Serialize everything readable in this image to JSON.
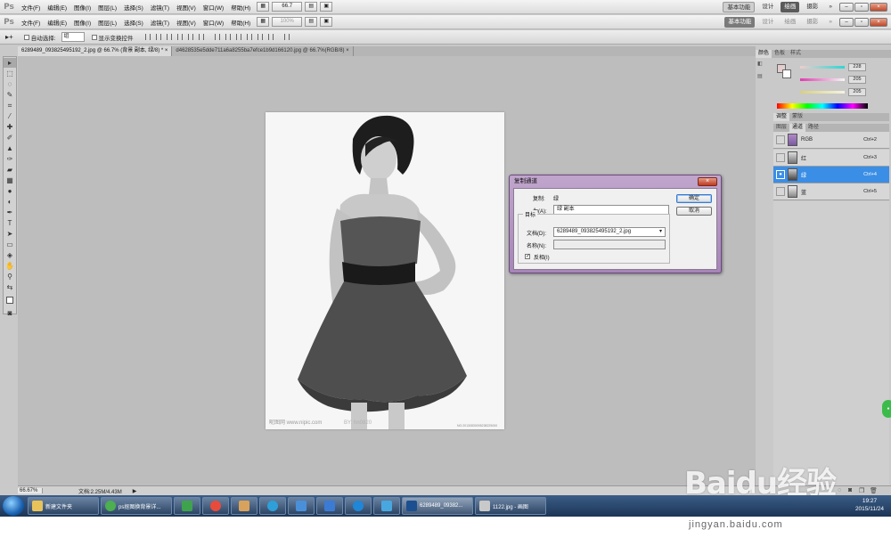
{
  "app": {
    "logo": "Ps",
    "menus": [
      "文件(F)",
      "编辑(E)",
      "图像(I)",
      "图层(L)",
      "选择(S)",
      "滤镜(T)",
      "视图(V)",
      "窗口(W)",
      "帮助(H)"
    ],
    "zoom_select": "66.7",
    "zoom_select_bg": "100%",
    "workspaces": [
      "基本功能",
      "设计",
      "绘画",
      "摄影"
    ],
    "active_workspace": "绘画",
    "more": "»"
  },
  "options_bar": {
    "auto_select_label": "自动选择:",
    "auto_select_value": "组",
    "show_transform_label": "显示变换控件"
  },
  "tabs": [
    {
      "label": "6289489_093825495192_2.jpg @ 66.7% (背景 副本, 绿/8) *",
      "close": "×"
    },
    {
      "label": "d4628535e5dde711a6a8255ba7efce1b9d166120.jpg @ 66.7%(RGB/8)",
      "close": "×"
    }
  ],
  "panels": {
    "color_tabs": [
      "颜色",
      "色板",
      "样式"
    ],
    "color_values": [
      "228",
      "205",
      "205"
    ],
    "adjust_tabs": [
      "调整",
      "蒙版"
    ],
    "channel_tabs": [
      "图层",
      "通道",
      "路径"
    ],
    "channels": [
      {
        "name": "RGB",
        "shortcut": "Ctrl+2",
        "selected": false
      },
      {
        "name": "红",
        "shortcut": "Ctrl+3",
        "selected": false
      },
      {
        "name": "绿",
        "shortcut": "Ctrl+4",
        "selected": true
      },
      {
        "name": "蓝",
        "shortcut": "Ctrl+5",
        "selected": false
      }
    ]
  },
  "dialog": {
    "title": "复制通道",
    "copy_label": "复制:",
    "copy_value": "绿",
    "as_label": "为(A):",
    "as_value": "绿 副本",
    "target_label": "目标",
    "doc_label": "文档(D):",
    "doc_value": "6289489_093825495192_2.jpg",
    "name_label": "名称(N):",
    "name_value": "",
    "invert_label": "反相(I)",
    "invert_checked": true,
    "ok_label": "确定",
    "cancel_label": "取消",
    "close": "×"
  },
  "photo_texts": {
    "watermark_left": "昵图网 www.nipic.com",
    "watermark_by": "BY: hn0820",
    "watermark_id": "NO:20130830095238225000"
  },
  "status": {
    "zoom": "66.67%",
    "doc_info": "文档:2.25M/4.43M"
  },
  "taskbar": {
    "items": [
      {
        "label": "新建文件夹",
        "icon_color": "#e8c35a",
        "type": "wide"
      },
      {
        "label": "ps抠图换背景详...",
        "icon_color": "#4caf50",
        "type": "wide"
      },
      {
        "label": "",
        "icon_color": "#3fa34d",
        "type": "icon"
      },
      {
        "label": "",
        "icon_color": "#e84b3c",
        "type": "icon"
      },
      {
        "label": "",
        "icon_color": "#d9a25c",
        "type": "icon"
      },
      {
        "label": "",
        "icon_color": "#2e9fd8",
        "type": "icon"
      },
      {
        "label": "",
        "icon_color": "#4a90d9",
        "type": "icon"
      },
      {
        "label": "",
        "icon_color": "#3b7bd4",
        "type": "icon"
      },
      {
        "label": "",
        "icon_color": "#1f86d8",
        "type": "icon"
      },
      {
        "label": "",
        "icon_color": "#49a7e0",
        "type": "icon"
      },
      {
        "label": "6289489_09382...",
        "icon_color": "#1c4f8f",
        "type": "wide",
        "active": true
      },
      {
        "label": "1122.jpg - 画图",
        "icon_color": "#c9c9c9",
        "type": "wide"
      }
    ],
    "time": "19:27",
    "date": "2015/11/24"
  },
  "watermark": {
    "brand": "Baidu经验",
    "url": "jingyan.baidu.com"
  },
  "colors": {
    "selection": "#3b8ee5",
    "dialog_frame": "#b79ac4"
  }
}
